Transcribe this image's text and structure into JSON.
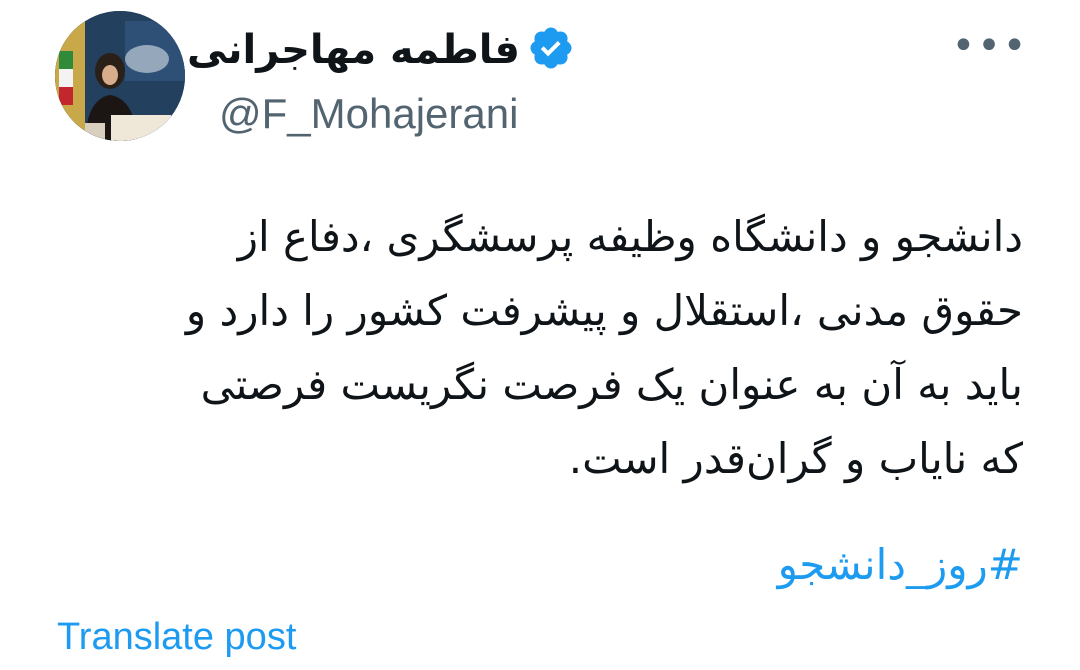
{
  "author": {
    "display_name": "فاطمه مهاجرانی",
    "handle": "@F_Mohajerani",
    "verified_icon": "verified-badge-icon",
    "avatar_icon": "profile-photo",
    "colors": {
      "verified_badge": "#1d9bf0",
      "handle_text": "#536471"
    }
  },
  "menu": {
    "more_icon": "more-horizontal-icon",
    "more_glyph": "•••"
  },
  "tweet": {
    "lines": [
      "دانشجو و دانشگاه وظیفه پرسشگری ،دفاع از",
      "حقوق مدنی ،استقلال و پیشرفت کشور را دارد و",
      "باید به آن به عنوان یک فرصت نگریست فرصتی",
      "که نایاب و گران‌قدر است."
    ],
    "hashtag": "#روز_دانشجو"
  },
  "actions": {
    "translate_label": "Translate post"
  },
  "colors": {
    "link": "#1d9bf0",
    "text": "#0f1419",
    "background": "#ffffff"
  }
}
